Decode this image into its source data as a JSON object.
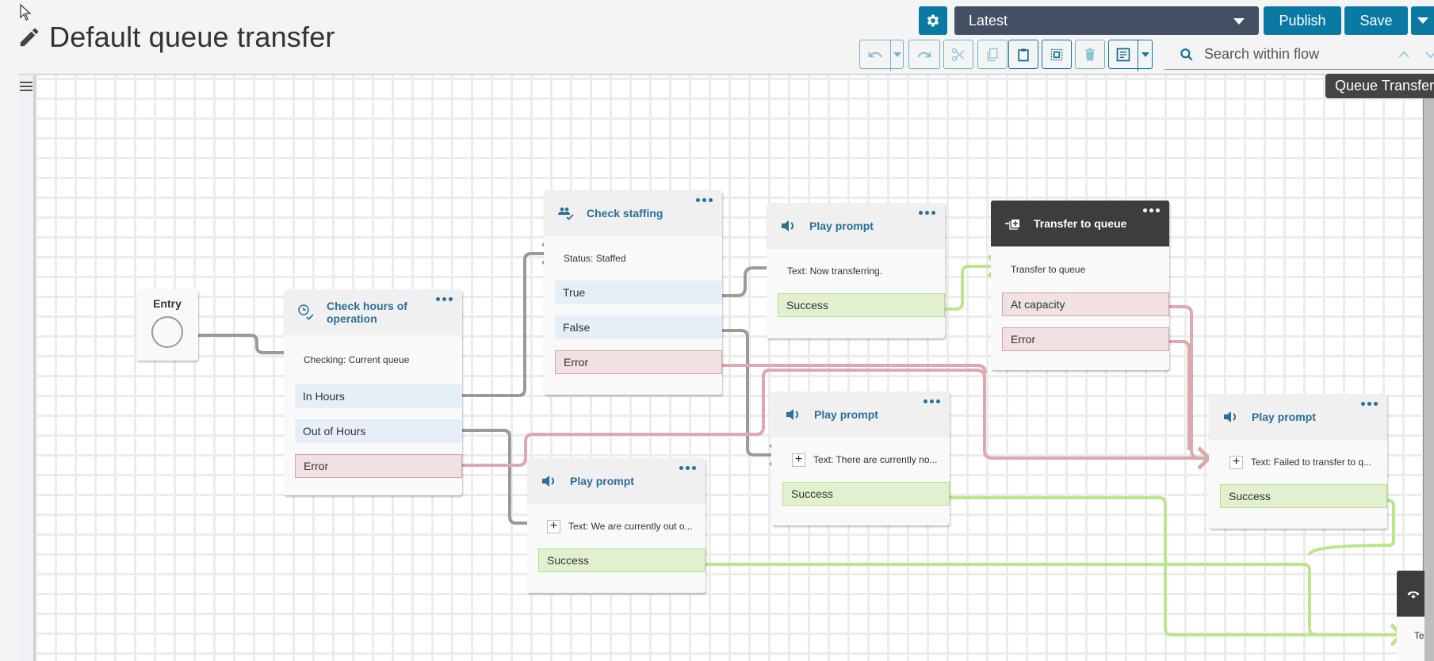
{
  "header": {
    "title": "Default queue transfer",
    "version_label": "Latest",
    "publish_label": "Publish",
    "save_label": "Save"
  },
  "toolbar": {
    "buttons": [
      "undo",
      "undo-menu",
      "redo",
      "cut",
      "copy",
      "paste",
      "select",
      "delete",
      "notes",
      "notes-menu"
    ]
  },
  "search": {
    "placeholder": "Search within flow",
    "value": ""
  },
  "tooltip": "Queue Transfer",
  "colors": {
    "accent": "#0a7aa5",
    "version_bg": "#434f63",
    "block_title": "#2a6f98",
    "wire_default": "#9a9a9a",
    "wire_error": "#dba9ae",
    "wire_success": "#bde58f"
  },
  "entry": {
    "label": "Entry"
  },
  "blocks": {
    "check_hours": {
      "title": "Check hours of operation",
      "info": "Checking: Current queue",
      "branches": [
        "In Hours",
        "Out of Hours",
        "Error"
      ]
    },
    "check_staffing": {
      "title": "Check staffing",
      "info": "Status: Staffed",
      "branches": [
        "True",
        "False",
        "Error"
      ]
    },
    "play_now_transferring": {
      "title": "Play prompt",
      "info": "Text: Now transferring.",
      "branches": [
        "Success"
      ]
    },
    "transfer_to_queue": {
      "title": "Transfer to queue",
      "info": "Transfer to queue",
      "branches": [
        "At capacity",
        "Error"
      ]
    },
    "play_no_agents": {
      "title": "Play prompt",
      "info": "Text: There are currently no...",
      "branches": [
        "Success"
      ]
    },
    "play_out_of_hours": {
      "title": "Play prompt",
      "info": "Text: We are currently out o...",
      "branches": [
        "Success"
      ]
    },
    "play_failed_transfer": {
      "title": "Play prompt",
      "info": "Text: Failed to transfer to q...",
      "branches": [
        "Success"
      ]
    },
    "disconnect_partial": {
      "info": "Te"
    }
  }
}
